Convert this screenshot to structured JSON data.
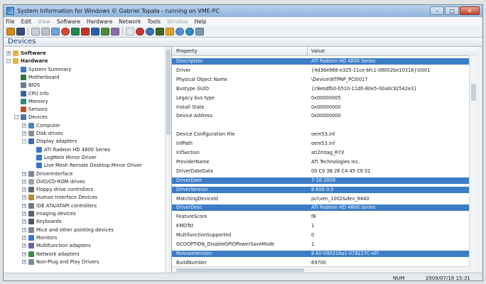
{
  "window": {
    "title": "System Information for Windows  © Gabriel Topala - running on VME-PC",
    "btn_minimize": "–",
    "btn_maximize": "□",
    "btn_close": "✕"
  },
  "menu": [
    "File",
    "Edit",
    "View",
    "Software",
    "Hardware",
    "Network",
    "Tools",
    "Window",
    "Help"
  ],
  "menu_disabled": [
    "View",
    "Window"
  ],
  "section_title": "Devices",
  "tree": [
    {
      "label": "Software",
      "indent": 0,
      "bold": true,
      "icon": "folder-icon",
      "exp": "+"
    },
    {
      "label": "Hardware",
      "indent": 0,
      "bold": true,
      "icon": "folder-icon",
      "exp": "-"
    },
    {
      "label": "System Summary",
      "indent": 1,
      "icon": "summary-icon"
    },
    {
      "label": "Motherboard",
      "indent": 1,
      "icon": "motherboard-icon"
    },
    {
      "label": "BIOS",
      "indent": 1,
      "icon": "bios-icon"
    },
    {
      "label": "CPU Info",
      "indent": 1,
      "icon": "cpu-icon"
    },
    {
      "label": "Memory",
      "indent": 1,
      "icon": "memory-icon"
    },
    {
      "label": "Sensors",
      "indent": 1,
      "icon": "sensors-icon"
    },
    {
      "label": "Devices",
      "indent": 1,
      "icon": "devices-icon",
      "exp": "-"
    },
    {
      "label": "Computer",
      "indent": 2,
      "icon": "computer-icon",
      "exp": "+"
    },
    {
      "label": "Disk drives",
      "indent": 2,
      "icon": "disk-icon",
      "exp": "+"
    },
    {
      "label": "Display adapters",
      "indent": 2,
      "icon": "display-icon",
      "exp": "-"
    },
    {
      "label": "ATI Radeon HD 4800 Series",
      "indent": 3,
      "icon": "monitor-icon"
    },
    {
      "label": "LogMeIn Mirror Driver",
      "indent": 3,
      "icon": "monitor-icon"
    },
    {
      "label": "Live Mesh Remote Desktop Mirror Driver",
      "indent": 3,
      "icon": "monitor-icon"
    },
    {
      "label": "DriverInterface",
      "indent": 2,
      "icon": "driver-icon",
      "exp": "+"
    },
    {
      "label": "DVD/CD-ROM drives",
      "indent": 2,
      "icon": "dvd-icon",
      "exp": "+"
    },
    {
      "label": "Floppy drive controllers",
      "indent": 2,
      "icon": "floppy-icon",
      "exp": "+"
    },
    {
      "label": "Human Interface Devices",
      "indent": 2,
      "icon": "hid-icon",
      "exp": "+"
    },
    {
      "label": "IDE ATA/ATAPI controllers",
      "indent": 2,
      "icon": "ide-icon",
      "exp": "+"
    },
    {
      "label": "Imaging devices",
      "indent": 2,
      "icon": "camera-icon",
      "exp": "+"
    },
    {
      "label": "Keyboards",
      "indent": 2,
      "icon": "keyboard-icon",
      "exp": "+"
    },
    {
      "label": "Mice and other pointing devices",
      "indent": 2,
      "icon": "mouse-icon",
      "exp": "+"
    },
    {
      "label": "Monitors",
      "indent": 2,
      "icon": "monitor-icon",
      "exp": "+"
    },
    {
      "label": "Multifunction adapters",
      "indent": 2,
      "icon": "adapter-icon",
      "exp": "+"
    },
    {
      "label": "Network adapters",
      "indent": 2,
      "icon": "network-icon",
      "exp": "+"
    },
    {
      "label": "Non-Plug and Play Drivers",
      "indent": 2,
      "icon": "driver-icon",
      "exp": "+"
    }
  ],
  "grid": {
    "col_property": "Property",
    "col_value": "Value",
    "rows": [
      {
        "p": "Description",
        "v": "ATI Radeon HD 4800 Series",
        "sel": true
      },
      {
        "p": "Driver",
        "v": "{4d36e968-e325-11ce-bfc1-08002be10318}\\0001"
      },
      {
        "p": "Physical Object Name",
        "v": "\\Device\\NTPNP_PCI0017"
      },
      {
        "p": "Bustype GUID",
        "v": "{c8ebdfb0-b510-11d0-80e5-00a0c92542e3}"
      },
      {
        "p": "Legacy bus type",
        "v": "0x00000005"
      },
      {
        "p": "Install State",
        "v": "0x00000000"
      },
      {
        "p": "Device Address",
        "v": "0x00000000"
      },
      {
        "p": "",
        "v": ""
      },
      {
        "p": "Device Configuration File",
        "v": "oem53.inf"
      },
      {
        "p": "InfPath",
        "v": "oem53.inf"
      },
      {
        "p": "InfSection",
        "v": "ati2mtag_R7X"
      },
      {
        "p": "ProviderName",
        "v": "ATI Technologies Inc."
      },
      {
        "p": "DriverDateData",
        "v": "00 C0 3B 26 C4 45 C9 01"
      },
      {
        "p": "DriverDate",
        "v": "7-16-2009",
        "sel": true
      },
      {
        "p": "DriverVersion",
        "v": "8.600.0.0",
        "sel": true
      },
      {
        "p": "MatchingDeviceId",
        "v": "pci\\ven_1002&dev_9440"
      },
      {
        "p": "DriverDesc",
        "v": "ATI Radeon HD 4800 Series",
        "sel": true
      },
      {
        "p": "FeatureScore",
        "v": "f8"
      },
      {
        "p": "KMDTst",
        "v": "1"
      },
      {
        "p": "MultifunctionSupported",
        "v": "0"
      },
      {
        "p": "GCOOPTION_DisableGPIOPowerSaveMode",
        "v": "1"
      },
      {
        "p": "ReleaseVersion",
        "v": "8.60-090316a1-078227C-ATI",
        "sel": true
      },
      {
        "p": "BuildNumber",
        "v": "69700"
      }
    ]
  },
  "status": {
    "num": "NUM",
    "datetime": "2009/07/16 15:31"
  },
  "colors": {
    "selection": "#3d7cc7",
    "titlebar": "#8fb3da"
  }
}
